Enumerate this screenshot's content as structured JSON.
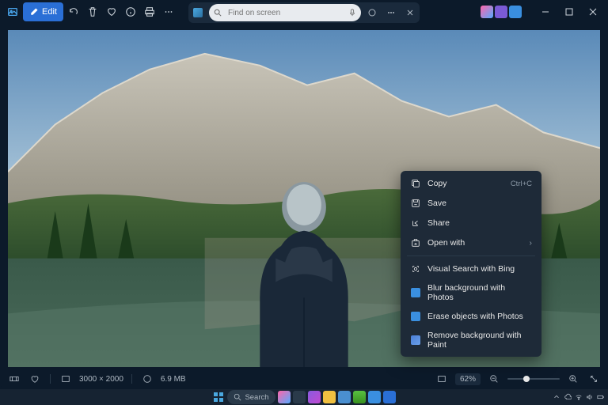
{
  "toolbar": {
    "edit": "Edit"
  },
  "search": {
    "placeholder": "Find on screen"
  },
  "context_menu": {
    "copy": "Copy",
    "copy_shortcut": "Ctrl+C",
    "save": "Save",
    "share": "Share",
    "open_with": "Open with",
    "visual_search": "Visual Search with Bing",
    "blur_bg": "Blur background with Photos",
    "erase": "Erase objects with Photos",
    "remove_bg": "Remove background with Paint"
  },
  "statusbar": {
    "dimensions": "3000 × 2000",
    "filesize": "6.9 MB",
    "zoom": "62%"
  },
  "taskbar": {
    "search": "Search"
  },
  "colors": {
    "accent_blue": "#2a6fd6",
    "photos_blue": "#3a8fe0",
    "paint_blue": "#4a7fd8"
  }
}
